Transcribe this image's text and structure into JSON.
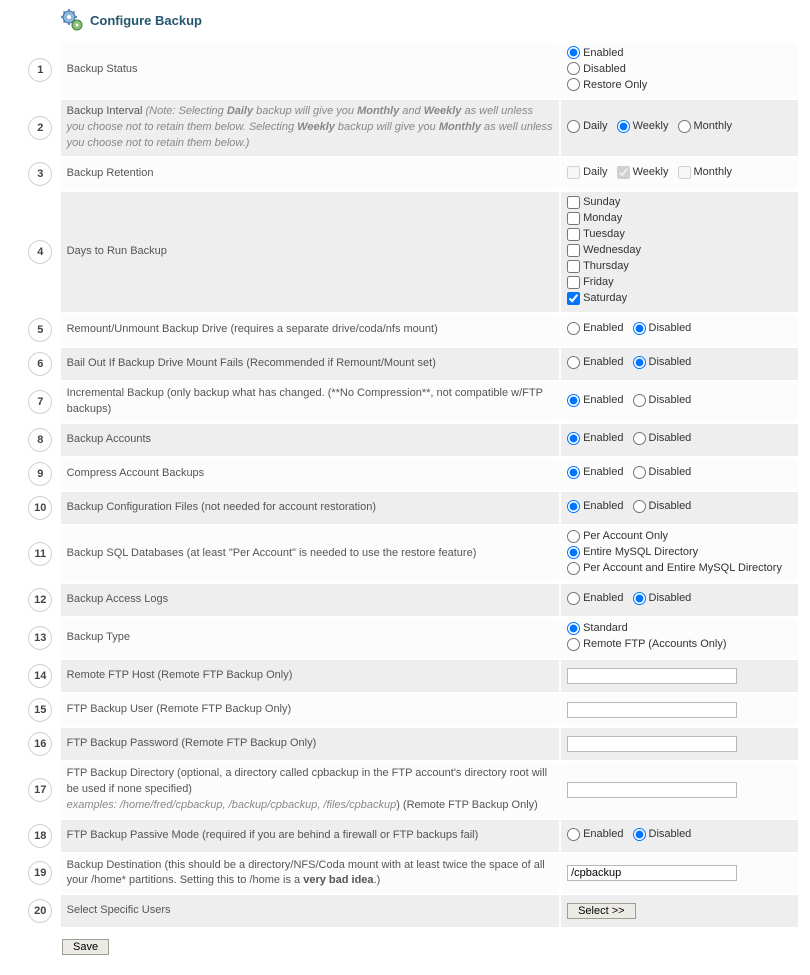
{
  "page": {
    "title": "Configure Backup"
  },
  "rows": {
    "r1": {
      "num": "1",
      "label": "Backup Status"
    },
    "r2": {
      "num": "2",
      "label_prefix": "Backup Interval ",
      "label_note1": "(Note: Selecting ",
      "label_note_daily": "Daily",
      "label_note2": " backup will give you ",
      "label_note_monthly": "Monthly",
      "label_note3": " and ",
      "label_note_weekly": "Weekly",
      "label_note4": " as well unless you choose not to retain them below. Selecting ",
      "label_note_weekly2": "Weekly",
      "label_note5": " backup will give you ",
      "label_note_monthly2": "Monthly",
      "label_note6": " as well unless you choose not to retain them below.)"
    },
    "r3": {
      "num": "3",
      "label": "Backup Retention"
    },
    "r4": {
      "num": "4",
      "label": "Days to Run Backup"
    },
    "r5": {
      "num": "5",
      "label": "Remount/Unmount Backup Drive (requires a separate drive/coda/nfs mount)"
    },
    "r6": {
      "num": "6",
      "label": "Bail Out If Backup Drive Mount Fails (Recommended if Remount/Mount set)"
    },
    "r7": {
      "num": "7",
      "label": "Incremental Backup (only backup what has changed. (**No Compression**, not compatible w/FTP backups)"
    },
    "r8": {
      "num": "8",
      "label": "Backup Accounts"
    },
    "r9": {
      "num": "9",
      "label": "Compress Account Backups"
    },
    "r10": {
      "num": "10",
      "label": "Backup Configuration Files (not needed for account restoration)"
    },
    "r11": {
      "num": "11",
      "label": "Backup SQL Databases (at least \"Per Account\" is needed to use the restore feature)"
    },
    "r12": {
      "num": "12",
      "label": "Backup Access Logs"
    },
    "r13": {
      "num": "13",
      "label": "Backup Type"
    },
    "r14": {
      "num": "14",
      "label": "Remote FTP Host (Remote FTP Backup Only)"
    },
    "r15": {
      "num": "15",
      "label": "FTP Backup User (Remote FTP Backup Only)"
    },
    "r16": {
      "num": "16",
      "label": "FTP Backup Password (Remote FTP Backup Only)"
    },
    "r17": {
      "num": "17",
      "label_line1": "FTP Backup Directory (optional, a directory called cpbackup in the FTP account's directory root will be used if none specified)",
      "label_examples_prefix": "examples: ",
      "label_examples_paths": "/home/fred/cpbackup, /backup/cpbackup, /files/cpbackup",
      "label_examples_suffix": ") (Remote FTP Backup Only)"
    },
    "r18": {
      "num": "18",
      "label": "FTP Backup Passive Mode (required if you are behind a firewall or FTP backups fail)"
    },
    "r19": {
      "num": "19",
      "label_prefix": "Backup Destination (this should be a directory/NFS/Coda mount with at least twice the space of all your /home* partitions. Setting this to /home is a ",
      "label_bold": "very bad idea",
      "label_suffix": ".)"
    },
    "r20": {
      "num": "20",
      "label": "Select Specific Users"
    }
  },
  "options": {
    "enabled": "Enabled",
    "disabled": "Disabled",
    "restore_only": "Restore Only",
    "daily": "Daily",
    "weekly": "Weekly",
    "monthly": "Monthly",
    "sunday": "Sunday",
    "monday": "Monday",
    "tuesday": "Tuesday",
    "wednesday": "Wednesday",
    "thursday": "Thursday",
    "friday": "Friday",
    "saturday": "Saturday",
    "per_account_only": "Per Account Only",
    "entire_mysql_dir": "Entire MySQL Directory",
    "per_account_and_entire": "Per Account and Entire MySQL Directory",
    "standard": "Standard",
    "remote_ftp": "Remote FTP (Accounts Only)"
  },
  "values": {
    "backup_status": "Enabled",
    "backup_interval": "Weekly",
    "retention_daily": false,
    "retention_weekly": true,
    "retention_monthly": false,
    "days": {
      "sunday": false,
      "monday": false,
      "tuesday": false,
      "wednesday": false,
      "thursday": false,
      "friday": false,
      "saturday": true
    },
    "remount": "Disabled",
    "bailout": "Disabled",
    "incremental": "Enabled",
    "backup_accounts": "Enabled",
    "compress": "Enabled",
    "backup_config_files": "Enabled",
    "sql_db": "Entire MySQL Directory",
    "access_logs": "Disabled",
    "backup_type": "Standard",
    "ftp_host": "",
    "ftp_user": "",
    "ftp_pass": "",
    "ftp_dir": "",
    "passive_mode": "Disabled",
    "backup_destination": "/cpbackup"
  },
  "buttons": {
    "select_users": "Select >>",
    "save": "Save"
  }
}
